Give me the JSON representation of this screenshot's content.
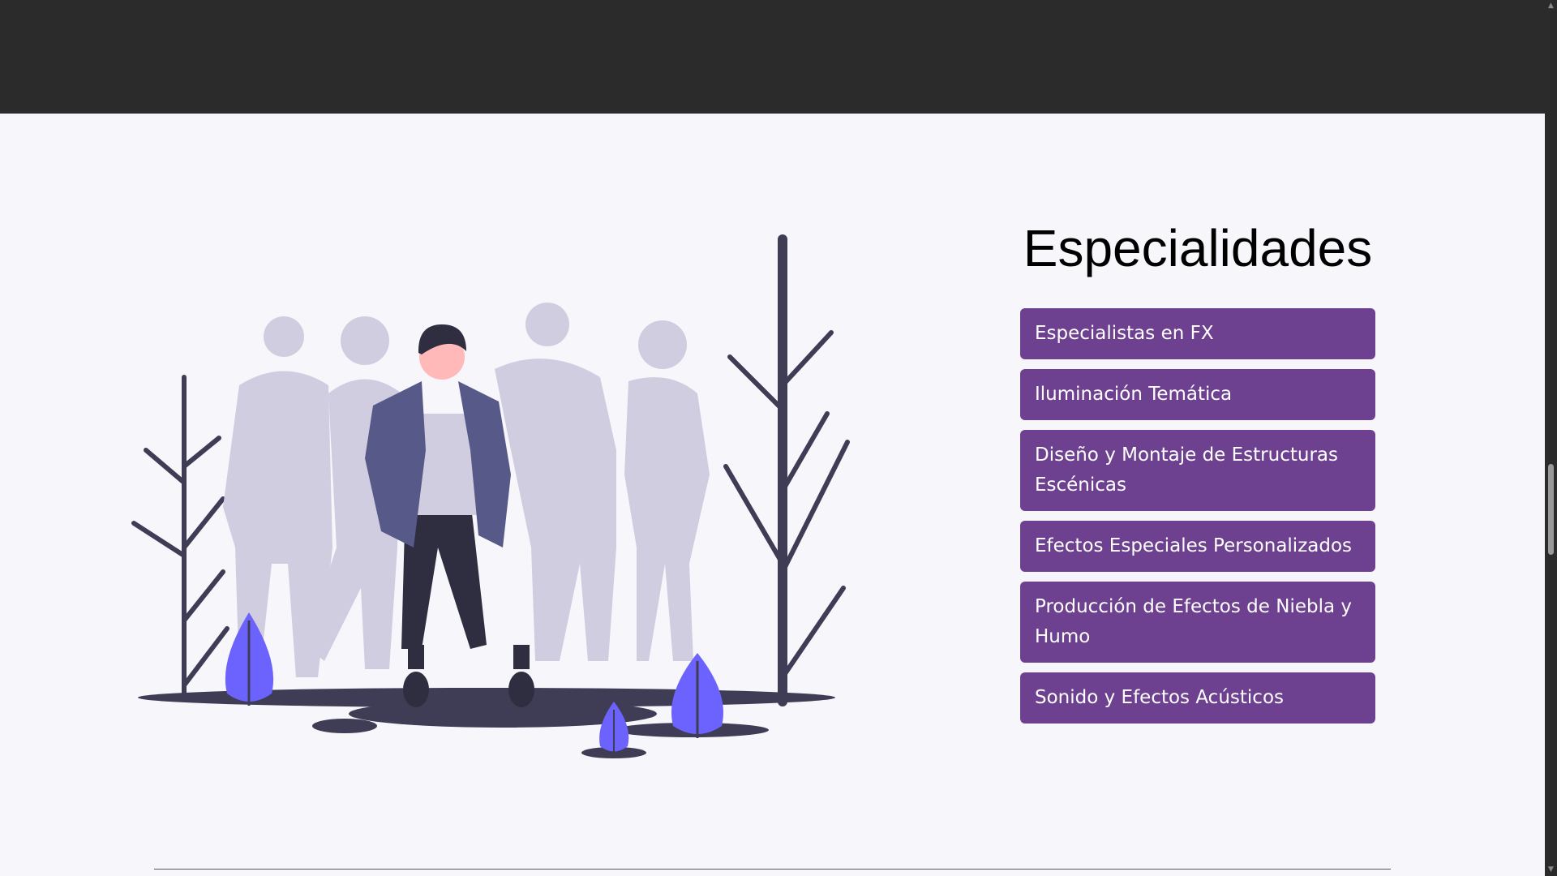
{
  "section": {
    "title": "Especialidades",
    "items": [
      {
        "label": "Especialistas en FX"
      },
      {
        "label": "Iluminación Temática"
      },
      {
        "label": "Diseño y Montaje de Estructuras Escénicas"
      },
      {
        "label": "Efectos Especiales Personalizados"
      },
      {
        "label": "Producción de Efectos de Niebla y Humo"
      },
      {
        "label": "Sonido y Efectos Acústicos"
      }
    ]
  },
  "colors": {
    "header_bg": "#2b2b2c",
    "page_bg": "#f7f6fb",
    "item_bg": "#6d4190",
    "accent_leaf": "#6c63ff",
    "silhouette": "#d0cde1",
    "dark": "#3f3d56"
  },
  "icons": {
    "scroll_up": "chevron-up-icon",
    "scroll_down": "chevron-down-icon"
  }
}
